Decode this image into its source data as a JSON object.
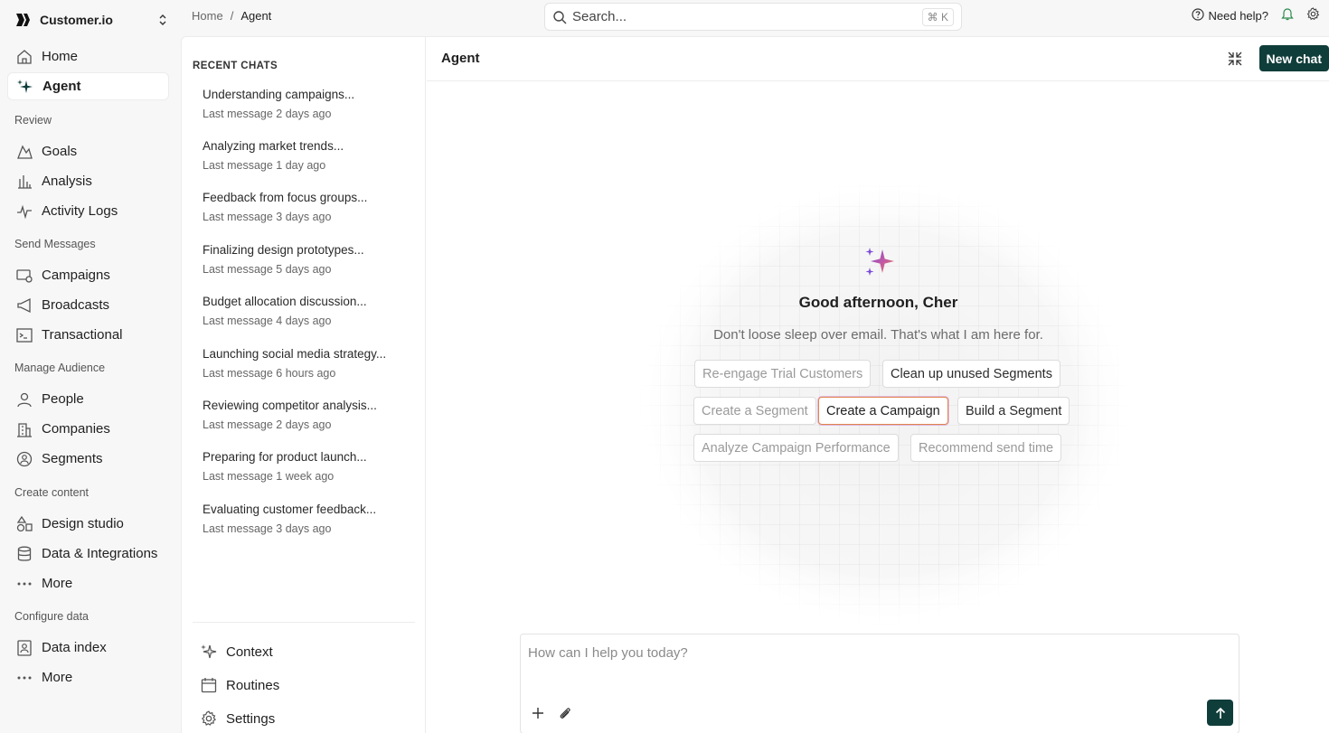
{
  "brand": {
    "name": "Customer.io"
  },
  "sidebar": {
    "items": [
      {
        "label": "Home",
        "icon": "home-icon"
      },
      {
        "label": "Agent",
        "icon": "sparkle-icon",
        "active": true
      }
    ],
    "sections": [
      {
        "title": "Review",
        "items": [
          {
            "label": "Goals"
          },
          {
            "label": "Analysis"
          },
          {
            "label": "Activity Logs"
          }
        ]
      },
      {
        "title": "Send Messages",
        "items": [
          {
            "label": "Campaigns"
          },
          {
            "label": "Broadcasts"
          },
          {
            "label": "Transactional"
          }
        ]
      },
      {
        "title": "Manage Audience",
        "items": [
          {
            "label": "People"
          },
          {
            "label": "Companies"
          },
          {
            "label": "Segments"
          }
        ]
      },
      {
        "title": "Create content",
        "items": [
          {
            "label": "Design studio"
          },
          {
            "label": "Data & Integrations"
          },
          {
            "label": "More"
          }
        ]
      },
      {
        "title": "Configure data",
        "items": [
          {
            "label": "Data index"
          },
          {
            "label": "More"
          }
        ]
      }
    ]
  },
  "breadcrumb": {
    "home": "Home",
    "sep": "/",
    "current": "Agent"
  },
  "search": {
    "placeholder": "Search...",
    "shortcut": "⌘ K"
  },
  "topright": {
    "help": "Need help?"
  },
  "recent": {
    "title": "RECENT CHATS",
    "chats": [
      {
        "title": "Understanding campaigns...",
        "sub": "Last message 2 days ago"
      },
      {
        "title": "Analyzing market trends...",
        "sub": "Last message 1 day ago"
      },
      {
        "title": "Feedback from focus groups...",
        "sub": "Last message 3 days ago"
      },
      {
        "title": "Finalizing design prototypes...",
        "sub": "Last message 5 days ago"
      },
      {
        "title": "Budget allocation discussion...",
        "sub": "Last message 4 days ago"
      },
      {
        "title": "Launching social media strategy...",
        "sub": "Last message 6 hours ago"
      },
      {
        "title": "Reviewing competitor analysis...",
        "sub": "Last message 2 days ago"
      },
      {
        "title": "Preparing for product launch...",
        "sub": "Last message 1 week ago"
      },
      {
        "title": "Evaluating customer feedback...",
        "sub": "Last message 3 days ago"
      }
    ],
    "footer": [
      {
        "label": "Context"
      },
      {
        "label": "Routines"
      },
      {
        "label": "Settings"
      }
    ]
  },
  "agent": {
    "title": "Agent",
    "new_chat": "New chat",
    "greeting": "Good afternoon, Cher",
    "subtitle": "Don't loose sleep over email. That's what I am here for.",
    "suggestions": [
      "Re-engage Trial Customers",
      "Clean up unused Segments",
      "Create a Segment",
      "Create a Campaign",
      "Build a Segment",
      "Analyze Campaign Performance",
      "Recommend send time"
    ],
    "composer_placeholder": "How can I help you today?"
  },
  "colors": {
    "primary": "#0f3d3a",
    "accent_orange": "#e0864e",
    "accent_purple": "#7b4bd6"
  }
}
